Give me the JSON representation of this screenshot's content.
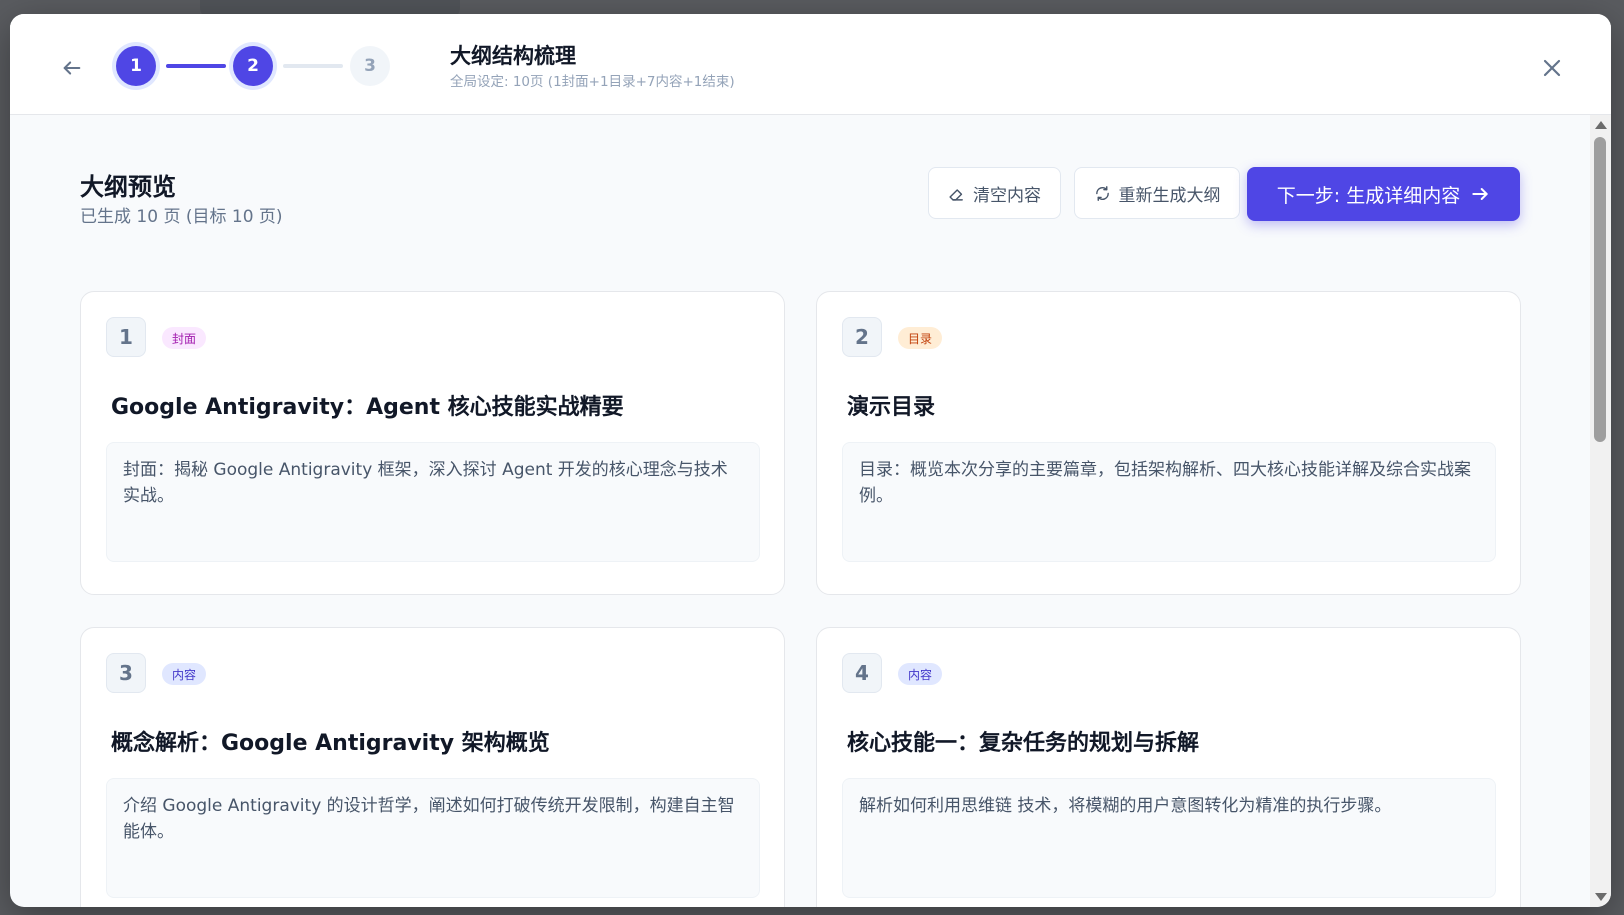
{
  "header": {
    "title": "大纲结构梳理",
    "subtitle": "全局设定: 10页 (1封面+1目录+7内容+1结束)",
    "steps": [
      {
        "label": "1",
        "state": "active"
      },
      {
        "label": "2",
        "state": "active"
      },
      {
        "label": "3",
        "state": "inactive"
      }
    ]
  },
  "section": {
    "title": "大纲预览",
    "subtitle": "已生成 10 页 (目标 10 页)"
  },
  "actions": {
    "clear_label": "清空内容",
    "regenerate_label": "重新生成大纲",
    "next_label": "下一步: 生成详细内容"
  },
  "cards": [
    {
      "number": "1",
      "tag": "封面",
      "title": "Google Antigravity：Agent 核心技能实战精要",
      "description": "封面：揭秘 Google Antigravity 框架，深入探讨 Agent 开发的核心理念与技术实战。"
    },
    {
      "number": "2",
      "tag": "目录",
      "title": "演示目录",
      "description": "目录：概览本次分享的主要篇章，包括架构解析、四大核心技能详解及综合实战案例。"
    },
    {
      "number": "3",
      "tag": "内容",
      "title": "概念解析：Google Antigravity 架构概览",
      "description": "介绍 Google Antigravity 的设计哲学，阐述如何打破传统开发限制，构建自主智能体。"
    },
    {
      "number": "4",
      "tag": "内容",
      "title": "核心技能一：复杂任务的规划与拆解",
      "description": "解析如何利用思维链 技术，将模糊的用户意图转化为精准的执行步骤。"
    }
  ],
  "colors": {
    "accent": "#4f46e5",
    "tag_cover_bg": "#fae8ff",
    "tag_cover_text": "#a21caf",
    "tag_toc_bg": "#ffedd5",
    "tag_toc_text": "#c2410c",
    "tag_content_bg": "#e0e7ff",
    "tag_content_text": "#4338ca"
  },
  "icons": {
    "back": "arrow-left-icon",
    "close": "close-icon",
    "clear": "eraser-icon",
    "regenerate": "refresh-icon",
    "next": "arrow-right-icon"
  }
}
